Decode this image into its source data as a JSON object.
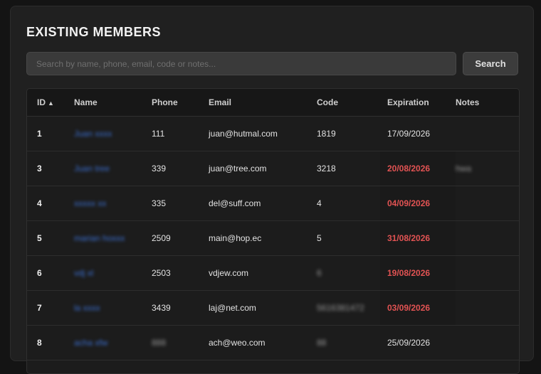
{
  "page": {
    "title": "EXISTING MEMBERS"
  },
  "search": {
    "placeholder": "Search by name, phone, email, code or notes...",
    "value": "",
    "button_label": "Search"
  },
  "table": {
    "columns": [
      "ID",
      "Name",
      "Phone",
      "Email",
      "Code",
      "Expiration",
      "Notes"
    ],
    "sort_indicator": "▲",
    "rows": [
      {
        "id": "1",
        "name": "Juan xxxx",
        "phone": "111",
        "email": "juan@hutmal.com",
        "code": "1819",
        "expiration": "17/09/2026",
        "expired": false,
        "notes": ""
      },
      {
        "id": "3",
        "name": "Juan tree",
        "phone": "339",
        "email": "juan@tree.com",
        "code": "3218",
        "expiration": "20/08/2026",
        "expired": true,
        "notes": "hwa"
      },
      {
        "id": "4",
        "name": "xxxxx xx",
        "phone": "335",
        "email": "del@suff.com",
        "code": "4",
        "expiration": "04/09/2026",
        "expired": true,
        "notes": ""
      },
      {
        "id": "5",
        "name": "marian hoxxx",
        "phone": "2509",
        "email": "main@hop.ec",
        "code": "5",
        "expiration": "31/08/2026",
        "expired": true,
        "notes": ""
      },
      {
        "id": "6",
        "name": "vdj xl",
        "phone": "2503",
        "email": "vdjew.com",
        "code": "6",
        "expiration": "19/08/2026",
        "expired": true,
        "notes": ""
      },
      {
        "id": "7",
        "name": "la xxxx",
        "phone": "3439",
        "email": "laj@net.com",
        "code": "5616381472",
        "expiration": "03/09/2026",
        "expired": true,
        "notes": ""
      },
      {
        "id": "8",
        "name": "acha xfw",
        "phone": "888",
        "email": "ach@weo.com",
        "code": "88",
        "expiration": "25/09/2026",
        "expired": false,
        "notes": ""
      }
    ]
  },
  "colors": {
    "expired": "#e25353",
    "link": "#3b6fd1",
    "background": "#141414",
    "panel": "#202020"
  }
}
